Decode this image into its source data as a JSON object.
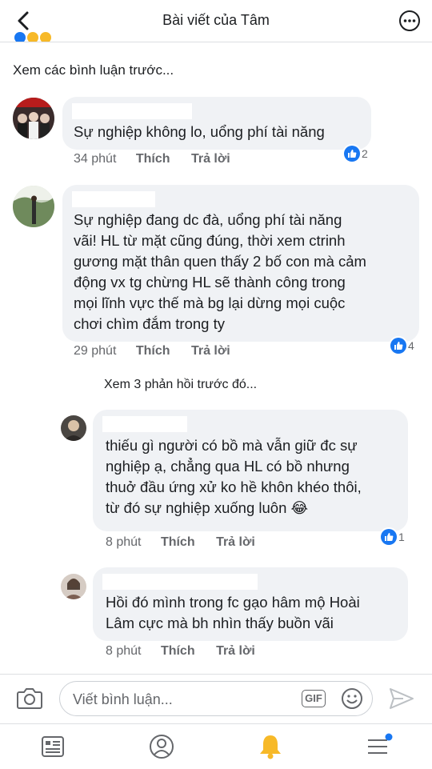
{
  "header": {
    "title": "Bài viết của Tâm"
  },
  "view_previous_label": "Xem các bình luận trước...",
  "comments": [
    {
      "text": "Sự nghiệp không lo, uổng phí tài năng",
      "time": "34 phút",
      "like_label": "Thích",
      "reply_label": "Trả lời",
      "reaction_count": "2"
    },
    {
      "text": "Sự nghiệp đang dc đà, uổng phí tài năng\nvãi! HL từ mặt cũng đúng, thời xem ctrinh\ngương mặt thân quen thấy 2 bố con mà cảm\nđộng vx tg chừng HL sẽ thành công trong\nmọi lĩnh vực thế mà bg lại dừng mọi cuộc\nchơi chìm đắm trong ty",
      "time": "29 phút",
      "like_label": "Thích",
      "reply_label": "Trả lời",
      "reaction_count": "4"
    }
  ],
  "view_replies_label": "Xem 3 phản hồi trước đó...",
  "replies": [
    {
      "text": "thiếu gì người có bồ mà vẫn giữ đc sự\nnghiệp ạ, chẳng qua HL có bồ nhưng\nthuở đầu ứng xử ko hề khôn khéo thôi,\ntừ đó sự nghiệp xuống luôn",
      "emoji": "😂",
      "time": "8 phút",
      "like_label": "Thích",
      "reply_label": "Trả lời",
      "reaction_count": "1"
    },
    {
      "text": "Hồi đó mình trong fc gạo hâm mộ Hoài\nLâm cực mà bh nhìn thấy buồn vãi",
      "time": "8 phút",
      "like_label": "Thích",
      "reply_label": "Trả lời"
    }
  ],
  "composer": {
    "placeholder": "Viết bình luận...",
    "gif_label": "GIF"
  },
  "colors": {
    "accent": "#1877f2",
    "bubble": "#f0f2f5",
    "secondary_text": "#65676b",
    "notification_bell": "#f7b928"
  },
  "icons": [
    "back-arrow-icon",
    "more-dots-icon",
    "camera-icon",
    "gif-icon",
    "emoji-icon",
    "send-icon",
    "news-feed-icon",
    "profile-icon",
    "bell-icon",
    "menu-icon",
    "like-icon"
  ]
}
